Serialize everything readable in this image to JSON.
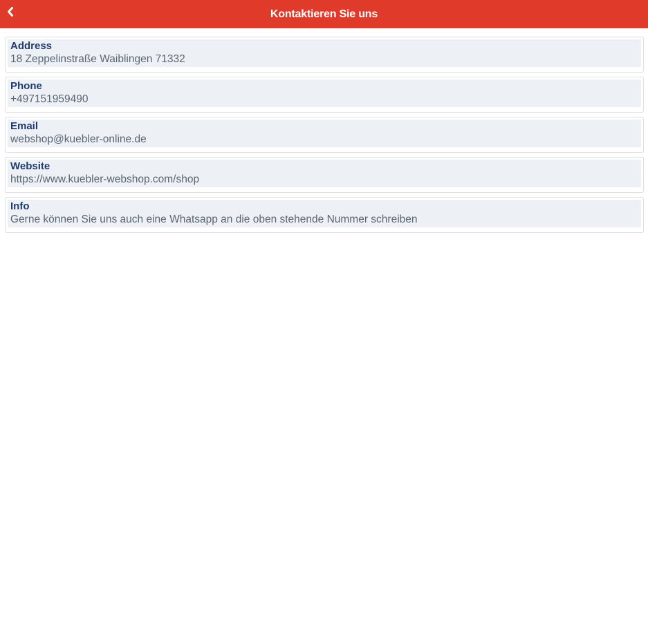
{
  "header": {
    "title": "Kontaktieren Sie uns",
    "back_icon": "chevron-left-icon",
    "background": "#e03a2a"
  },
  "contact": {
    "items": [
      {
        "label": "Address",
        "value": "18 Zeppelinstraße Waiblingen 71332"
      },
      {
        "label": "Phone",
        "value": "+497151959490"
      },
      {
        "label": "Email",
        "value": "webshop@kuebler-online.de"
      },
      {
        "label": "Website",
        "value": "https://www.kuebler-webshop.com/shop"
      },
      {
        "label": "Info",
        "value": "Gerne können Sie uns auch eine Whatsapp an die oben stehende Nummer schreiben"
      }
    ]
  }
}
